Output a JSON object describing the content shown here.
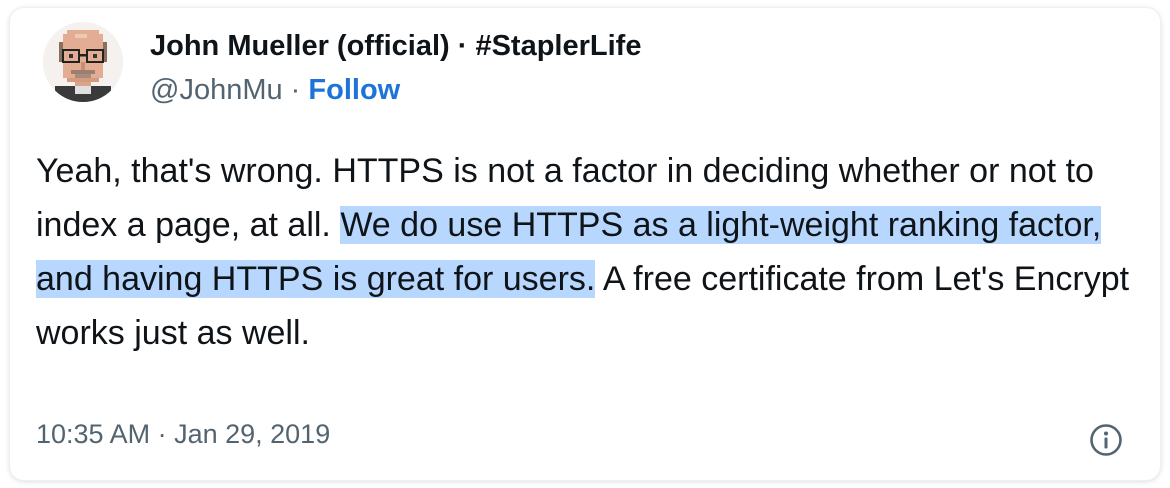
{
  "tweet": {
    "author": {
      "display_name": "John Mueller (official) · #StaplerLife",
      "handle": "@JohnMu",
      "separator": " · ",
      "follow_label": "Follow",
      "avatar_icon": "pixel-portrait-avatar"
    },
    "text": {
      "part1": "Yeah, that's wrong. HTTPS is not a factor in deciding whether or not to index a page, at all. ",
      "highlighted": "We do use HTTPS as a light-weight ranking factor, and having HTTPS is great for users.",
      "part2": " A free certificate from Let's Encrypt works just as well."
    },
    "timestamp": "10:35 AM · Jan 29, 2019",
    "info_icon": "info-circle-icon"
  },
  "colors": {
    "name": "#0f1419",
    "secondary": "#536471",
    "follow": "#1d73d8",
    "highlight": "#b8d7ff"
  }
}
